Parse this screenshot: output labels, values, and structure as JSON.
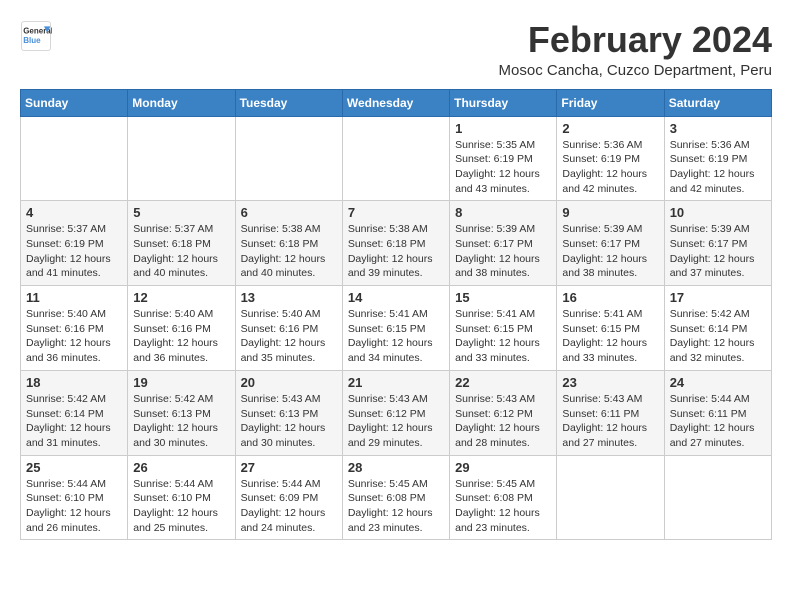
{
  "logo": {
    "line1": "General",
    "line2": "Blue"
  },
  "title": "February 2024",
  "location": "Mosoc Cancha, Cuzco Department, Peru",
  "days_of_week": [
    "Sunday",
    "Monday",
    "Tuesday",
    "Wednesday",
    "Thursday",
    "Friday",
    "Saturday"
  ],
  "weeks": [
    [
      {
        "day": "",
        "info": ""
      },
      {
        "day": "",
        "info": ""
      },
      {
        "day": "",
        "info": ""
      },
      {
        "day": "",
        "info": ""
      },
      {
        "day": "1",
        "info": "Sunrise: 5:35 AM\nSunset: 6:19 PM\nDaylight: 12 hours\nand 43 minutes."
      },
      {
        "day": "2",
        "info": "Sunrise: 5:36 AM\nSunset: 6:19 PM\nDaylight: 12 hours\nand 42 minutes."
      },
      {
        "day": "3",
        "info": "Sunrise: 5:36 AM\nSunset: 6:19 PM\nDaylight: 12 hours\nand 42 minutes."
      }
    ],
    [
      {
        "day": "4",
        "info": "Sunrise: 5:37 AM\nSunset: 6:19 PM\nDaylight: 12 hours\nand 41 minutes."
      },
      {
        "day": "5",
        "info": "Sunrise: 5:37 AM\nSunset: 6:18 PM\nDaylight: 12 hours\nand 40 minutes."
      },
      {
        "day": "6",
        "info": "Sunrise: 5:38 AM\nSunset: 6:18 PM\nDaylight: 12 hours\nand 40 minutes."
      },
      {
        "day": "7",
        "info": "Sunrise: 5:38 AM\nSunset: 6:18 PM\nDaylight: 12 hours\nand 39 minutes."
      },
      {
        "day": "8",
        "info": "Sunrise: 5:39 AM\nSunset: 6:17 PM\nDaylight: 12 hours\nand 38 minutes."
      },
      {
        "day": "9",
        "info": "Sunrise: 5:39 AM\nSunset: 6:17 PM\nDaylight: 12 hours\nand 38 minutes."
      },
      {
        "day": "10",
        "info": "Sunrise: 5:39 AM\nSunset: 6:17 PM\nDaylight: 12 hours\nand 37 minutes."
      }
    ],
    [
      {
        "day": "11",
        "info": "Sunrise: 5:40 AM\nSunset: 6:16 PM\nDaylight: 12 hours\nand 36 minutes."
      },
      {
        "day": "12",
        "info": "Sunrise: 5:40 AM\nSunset: 6:16 PM\nDaylight: 12 hours\nand 36 minutes."
      },
      {
        "day": "13",
        "info": "Sunrise: 5:40 AM\nSunset: 6:16 PM\nDaylight: 12 hours\nand 35 minutes."
      },
      {
        "day": "14",
        "info": "Sunrise: 5:41 AM\nSunset: 6:15 PM\nDaylight: 12 hours\nand 34 minutes."
      },
      {
        "day": "15",
        "info": "Sunrise: 5:41 AM\nSunset: 6:15 PM\nDaylight: 12 hours\nand 33 minutes."
      },
      {
        "day": "16",
        "info": "Sunrise: 5:41 AM\nSunset: 6:15 PM\nDaylight: 12 hours\nand 33 minutes."
      },
      {
        "day": "17",
        "info": "Sunrise: 5:42 AM\nSunset: 6:14 PM\nDaylight: 12 hours\nand 32 minutes."
      }
    ],
    [
      {
        "day": "18",
        "info": "Sunrise: 5:42 AM\nSunset: 6:14 PM\nDaylight: 12 hours\nand 31 minutes."
      },
      {
        "day": "19",
        "info": "Sunrise: 5:42 AM\nSunset: 6:13 PM\nDaylight: 12 hours\nand 30 minutes."
      },
      {
        "day": "20",
        "info": "Sunrise: 5:43 AM\nSunset: 6:13 PM\nDaylight: 12 hours\nand 30 minutes."
      },
      {
        "day": "21",
        "info": "Sunrise: 5:43 AM\nSunset: 6:12 PM\nDaylight: 12 hours\nand 29 minutes."
      },
      {
        "day": "22",
        "info": "Sunrise: 5:43 AM\nSunset: 6:12 PM\nDaylight: 12 hours\nand 28 minutes."
      },
      {
        "day": "23",
        "info": "Sunrise: 5:43 AM\nSunset: 6:11 PM\nDaylight: 12 hours\nand 27 minutes."
      },
      {
        "day": "24",
        "info": "Sunrise: 5:44 AM\nSunset: 6:11 PM\nDaylight: 12 hours\nand 27 minutes."
      }
    ],
    [
      {
        "day": "25",
        "info": "Sunrise: 5:44 AM\nSunset: 6:10 PM\nDaylight: 12 hours\nand 26 minutes."
      },
      {
        "day": "26",
        "info": "Sunrise: 5:44 AM\nSunset: 6:10 PM\nDaylight: 12 hours\nand 25 minutes."
      },
      {
        "day": "27",
        "info": "Sunrise: 5:44 AM\nSunset: 6:09 PM\nDaylight: 12 hours\nand 24 minutes."
      },
      {
        "day": "28",
        "info": "Sunrise: 5:45 AM\nSunset: 6:08 PM\nDaylight: 12 hours\nand 23 minutes."
      },
      {
        "day": "29",
        "info": "Sunrise: 5:45 AM\nSunset: 6:08 PM\nDaylight: 12 hours\nand 23 minutes."
      },
      {
        "day": "",
        "info": ""
      },
      {
        "day": "",
        "info": ""
      }
    ]
  ]
}
